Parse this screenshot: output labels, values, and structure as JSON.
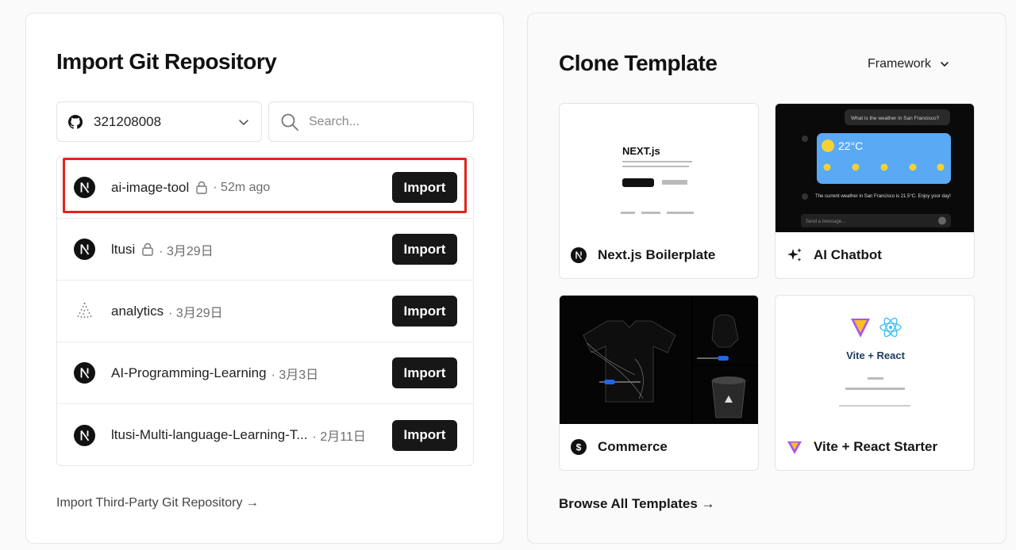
{
  "import_panel": {
    "title": "Import Git Repository",
    "account": {
      "value": "321208008",
      "icon": "github-icon"
    },
    "search": {
      "placeholder": "Search..."
    },
    "repos": [
      {
        "name": "ai-image-tool",
        "private": true,
        "meta": "· 52m ago",
        "icon": "nextjs-icon",
        "action": "Import"
      },
      {
        "name": "ltusi",
        "private": true,
        "meta": "· 3月29日",
        "icon": "nextjs-icon",
        "action": "Import"
      },
      {
        "name": "analytics",
        "private": false,
        "meta": "· 3月29日",
        "icon": "triangle-dots-icon",
        "action": "Import"
      },
      {
        "name": "AI-Programming-Learning",
        "private": false,
        "meta": "· 3月3日",
        "icon": "nextjs-icon",
        "action": "Import"
      },
      {
        "name": "ltusi-Multi-language-Learning-T...",
        "private": false,
        "meta": "· 2月11日",
        "icon": "nextjs-icon",
        "action": "Import"
      }
    ],
    "third_party_link": "Import Third-Party Git Repository →",
    "highlight_color": "#e3231c"
  },
  "clone_panel": {
    "title": "Clone Template",
    "framework_filter": "Framework",
    "templates": [
      {
        "name": "Next.js Boilerplate",
        "icon": "nextjs-icon"
      },
      {
        "name": "AI Chatbot",
        "icon": "sparkles-icon"
      },
      {
        "name": "Commerce",
        "icon": "dollar-icon"
      },
      {
        "name": "Vite + React Starter",
        "icon": "vite-icon"
      }
    ],
    "thumbs": {
      "next_logo": "NEXT.js",
      "ai_question": "What is the weather in San Francisco?",
      "ai_temp": "22°C",
      "ai_answer": "The current weather in San Francisco is 21.5°C. Enjoy your day!",
      "ai_input_placeholder": "Send a message...",
      "vite_title": "Vite + React"
    },
    "browse_link": "Browse All Templates →"
  },
  "colors": {
    "button_bg": "#171717",
    "accent_red": "#e3231c",
    "weather_blue": "#5aa9f5"
  }
}
